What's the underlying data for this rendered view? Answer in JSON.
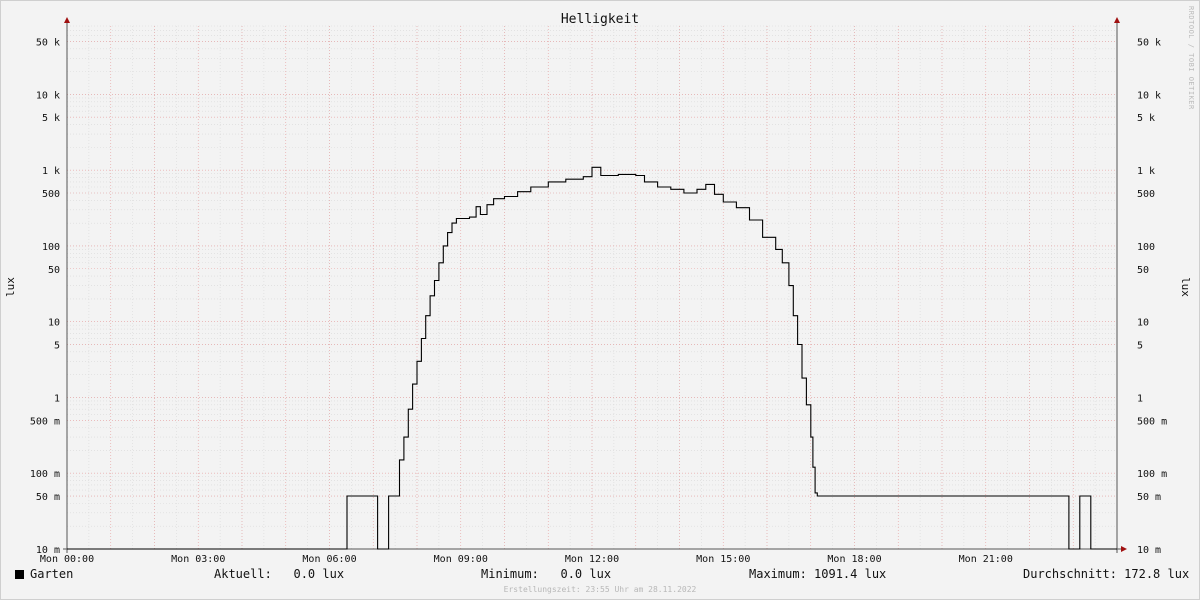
{
  "chart_data": {
    "type": "line",
    "title": "Helligkeit",
    "ylabel": "lux",
    "yscale": "log",
    "ylim": [
      0.01,
      80000
    ],
    "xlim_hours": [
      0,
      24
    ],
    "x_tick_labels": [
      "Mon 00:00",
      "Mon 03:00",
      "Mon 06:00",
      "Mon 09:00",
      "Mon 12:00",
      "Mon 15:00",
      "Mon 18:00",
      "Mon 21:00"
    ],
    "y_ticks": [
      {
        "value": 50000,
        "label": "50 k"
      },
      {
        "value": 10000,
        "label": "10 k"
      },
      {
        "value": 5000,
        "label": "5 k"
      },
      {
        "value": 1000,
        "label": "1 k"
      },
      {
        "value": 500,
        "label": "500"
      },
      {
        "value": 100,
        "label": "100"
      },
      {
        "value": 50,
        "label": "50"
      },
      {
        "value": 10,
        "label": "10"
      },
      {
        "value": 5,
        "label": "5"
      },
      {
        "value": 1,
        "label": "1"
      },
      {
        "value": 0.5,
        "label": "500 m"
      },
      {
        "value": 0.1,
        "label": "100 m"
      },
      {
        "value": 0.05,
        "label": "50 m"
      },
      {
        "value": 0.01,
        "label": "10 m"
      }
    ],
    "grid": true,
    "series": [
      {
        "name": "Garten",
        "color": "#000000",
        "points": [
          [
            0,
            0.01
          ],
          [
            6.4,
            0.01
          ],
          [
            6.4,
            0.05
          ],
          [
            7.1,
            0.05
          ],
          [
            7.1,
            0.01
          ],
          [
            7.35,
            0.01
          ],
          [
            7.35,
            0.05
          ],
          [
            7.55,
            0.05
          ],
          [
            7.6,
            0.15
          ],
          [
            7.7,
            0.3
          ],
          [
            7.8,
            0.7
          ],
          [
            7.9,
            1.5
          ],
          [
            8.0,
            3
          ],
          [
            8.1,
            6
          ],
          [
            8.2,
            12
          ],
          [
            8.3,
            22
          ],
          [
            8.4,
            35
          ],
          [
            8.5,
            60
          ],
          [
            8.6,
            100
          ],
          [
            8.7,
            150
          ],
          [
            8.8,
            200
          ],
          [
            8.9,
            230
          ],
          [
            9.0,
            230
          ],
          [
            9.2,
            240
          ],
          [
            9.35,
            330
          ],
          [
            9.45,
            260
          ],
          [
            9.6,
            350
          ],
          [
            9.75,
            420
          ],
          [
            10.0,
            450
          ],
          [
            10.3,
            520
          ],
          [
            10.6,
            600
          ],
          [
            11.0,
            700
          ],
          [
            11.4,
            760
          ],
          [
            11.8,
            820
          ],
          [
            12.0,
            1091.4
          ],
          [
            12.2,
            850
          ],
          [
            12.6,
            880
          ],
          [
            13.0,
            850
          ],
          [
            13.2,
            700
          ],
          [
            13.5,
            600
          ],
          [
            13.8,
            560
          ],
          [
            14.1,
            500
          ],
          [
            14.4,
            560
          ],
          [
            14.6,
            650
          ],
          [
            14.8,
            480
          ],
          [
            15.0,
            380
          ],
          [
            15.3,
            320
          ],
          [
            15.6,
            220
          ],
          [
            15.9,
            130
          ],
          [
            16.2,
            90
          ],
          [
            16.35,
            60
          ],
          [
            16.5,
            30
          ],
          [
            16.6,
            12
          ],
          [
            16.7,
            5
          ],
          [
            16.8,
            1.8
          ],
          [
            16.9,
            0.8
          ],
          [
            17.0,
            0.3
          ],
          [
            17.05,
            0.12
          ],
          [
            17.1,
            0.055
          ],
          [
            17.15,
            0.05
          ],
          [
            22.9,
            0.05
          ],
          [
            22.9,
            0.01
          ],
          [
            23.15,
            0.01
          ],
          [
            23.15,
            0.05
          ],
          [
            23.4,
            0.05
          ],
          [
            23.4,
            0.01
          ],
          [
            24,
            0.01
          ]
        ]
      }
    ],
    "legend_placement": "bottom-left"
  },
  "axis_labels": {
    "left": "lux",
    "right": "lux"
  },
  "watermark": "RRDTOOL / TOBI OETIKER",
  "legend": {
    "series_name": "Garten",
    "current": "Aktuell:   0.0 lux",
    "minimum": "Minimum:   0.0 lux",
    "maximum": "Maximum: 1091.4 lux",
    "average": "Durchschnitt: 172.8 lux"
  },
  "footer": "Erstellungszeit: 23:55 Uhr am 28.11.2022"
}
